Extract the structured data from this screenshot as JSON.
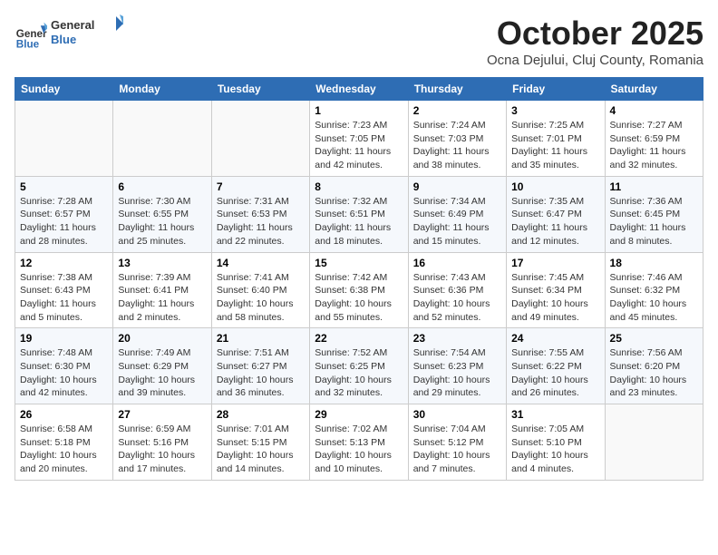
{
  "header": {
    "logo_line1": "General",
    "logo_line2": "Blue",
    "month": "October 2025",
    "location": "Ocna Dejului, Cluj County, Romania"
  },
  "weekdays": [
    "Sunday",
    "Monday",
    "Tuesday",
    "Wednesday",
    "Thursday",
    "Friday",
    "Saturday"
  ],
  "weeks": [
    [
      {
        "day": "",
        "info": ""
      },
      {
        "day": "",
        "info": ""
      },
      {
        "day": "",
        "info": ""
      },
      {
        "day": "1",
        "info": "Sunrise: 7:23 AM\nSunset: 7:05 PM\nDaylight: 11 hours and 42 minutes."
      },
      {
        "day": "2",
        "info": "Sunrise: 7:24 AM\nSunset: 7:03 PM\nDaylight: 11 hours and 38 minutes."
      },
      {
        "day": "3",
        "info": "Sunrise: 7:25 AM\nSunset: 7:01 PM\nDaylight: 11 hours and 35 minutes."
      },
      {
        "day": "4",
        "info": "Sunrise: 7:27 AM\nSunset: 6:59 PM\nDaylight: 11 hours and 32 minutes."
      }
    ],
    [
      {
        "day": "5",
        "info": "Sunrise: 7:28 AM\nSunset: 6:57 PM\nDaylight: 11 hours and 28 minutes."
      },
      {
        "day": "6",
        "info": "Sunrise: 7:30 AM\nSunset: 6:55 PM\nDaylight: 11 hours and 25 minutes."
      },
      {
        "day": "7",
        "info": "Sunrise: 7:31 AM\nSunset: 6:53 PM\nDaylight: 11 hours and 22 minutes."
      },
      {
        "day": "8",
        "info": "Sunrise: 7:32 AM\nSunset: 6:51 PM\nDaylight: 11 hours and 18 minutes."
      },
      {
        "day": "9",
        "info": "Sunrise: 7:34 AM\nSunset: 6:49 PM\nDaylight: 11 hours and 15 minutes."
      },
      {
        "day": "10",
        "info": "Sunrise: 7:35 AM\nSunset: 6:47 PM\nDaylight: 11 hours and 12 minutes."
      },
      {
        "day": "11",
        "info": "Sunrise: 7:36 AM\nSunset: 6:45 PM\nDaylight: 11 hours and 8 minutes."
      }
    ],
    [
      {
        "day": "12",
        "info": "Sunrise: 7:38 AM\nSunset: 6:43 PM\nDaylight: 11 hours and 5 minutes."
      },
      {
        "day": "13",
        "info": "Sunrise: 7:39 AM\nSunset: 6:41 PM\nDaylight: 11 hours and 2 minutes."
      },
      {
        "day": "14",
        "info": "Sunrise: 7:41 AM\nSunset: 6:40 PM\nDaylight: 10 hours and 58 minutes."
      },
      {
        "day": "15",
        "info": "Sunrise: 7:42 AM\nSunset: 6:38 PM\nDaylight: 10 hours and 55 minutes."
      },
      {
        "day": "16",
        "info": "Sunrise: 7:43 AM\nSunset: 6:36 PM\nDaylight: 10 hours and 52 minutes."
      },
      {
        "day": "17",
        "info": "Sunrise: 7:45 AM\nSunset: 6:34 PM\nDaylight: 10 hours and 49 minutes."
      },
      {
        "day": "18",
        "info": "Sunrise: 7:46 AM\nSunset: 6:32 PM\nDaylight: 10 hours and 45 minutes."
      }
    ],
    [
      {
        "day": "19",
        "info": "Sunrise: 7:48 AM\nSunset: 6:30 PM\nDaylight: 10 hours and 42 minutes."
      },
      {
        "day": "20",
        "info": "Sunrise: 7:49 AM\nSunset: 6:29 PM\nDaylight: 10 hours and 39 minutes."
      },
      {
        "day": "21",
        "info": "Sunrise: 7:51 AM\nSunset: 6:27 PM\nDaylight: 10 hours and 36 minutes."
      },
      {
        "day": "22",
        "info": "Sunrise: 7:52 AM\nSunset: 6:25 PM\nDaylight: 10 hours and 32 minutes."
      },
      {
        "day": "23",
        "info": "Sunrise: 7:54 AM\nSunset: 6:23 PM\nDaylight: 10 hours and 29 minutes."
      },
      {
        "day": "24",
        "info": "Sunrise: 7:55 AM\nSunset: 6:22 PM\nDaylight: 10 hours and 26 minutes."
      },
      {
        "day": "25",
        "info": "Sunrise: 7:56 AM\nSunset: 6:20 PM\nDaylight: 10 hours and 23 minutes."
      }
    ],
    [
      {
        "day": "26",
        "info": "Sunrise: 6:58 AM\nSunset: 5:18 PM\nDaylight: 10 hours and 20 minutes."
      },
      {
        "day": "27",
        "info": "Sunrise: 6:59 AM\nSunset: 5:16 PM\nDaylight: 10 hours and 17 minutes."
      },
      {
        "day": "28",
        "info": "Sunrise: 7:01 AM\nSunset: 5:15 PM\nDaylight: 10 hours and 14 minutes."
      },
      {
        "day": "29",
        "info": "Sunrise: 7:02 AM\nSunset: 5:13 PM\nDaylight: 10 hours and 10 minutes."
      },
      {
        "day": "30",
        "info": "Sunrise: 7:04 AM\nSunset: 5:12 PM\nDaylight: 10 hours and 7 minutes."
      },
      {
        "day": "31",
        "info": "Sunrise: 7:05 AM\nSunset: 5:10 PM\nDaylight: 10 hours and 4 minutes."
      },
      {
        "day": "",
        "info": ""
      }
    ]
  ]
}
